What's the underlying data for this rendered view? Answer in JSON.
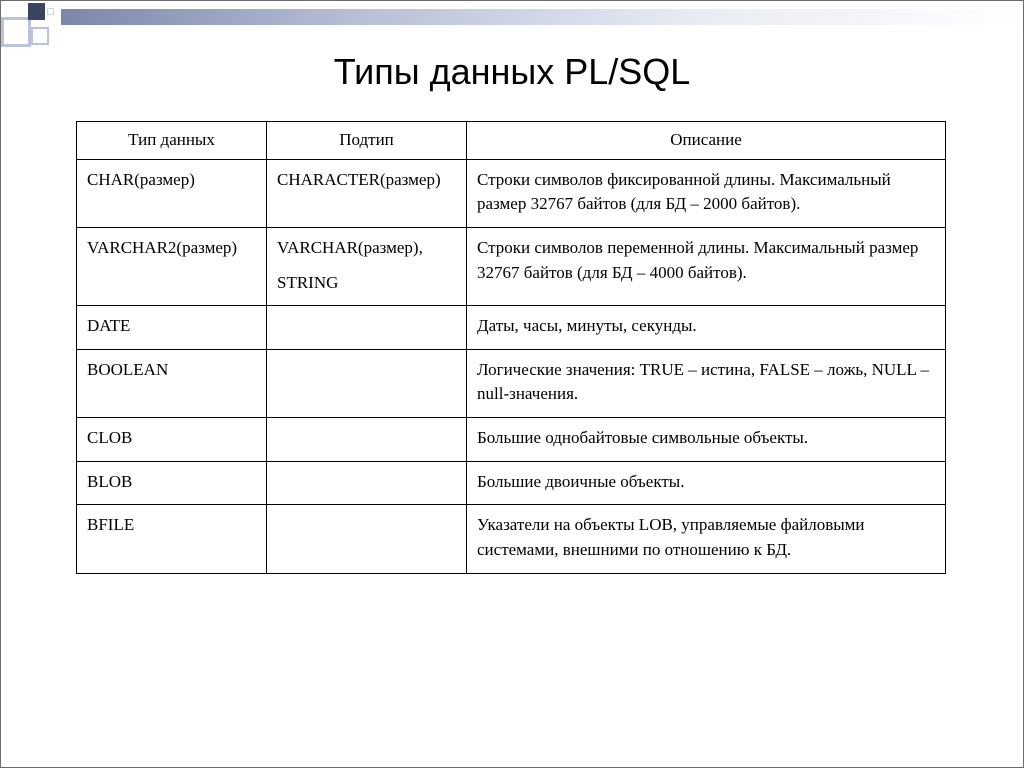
{
  "title": "Типы данных PL/SQL",
  "columns": {
    "c1": "Тип данных",
    "c2": "Подтип",
    "c3": "Описание"
  },
  "rows": [
    {
      "type": "CHAR(размер)",
      "sub1": "CHARACTER(размер)",
      "sub2": "",
      "desc": "Строки символов фиксированной длины. Максимальный размер 32767 байтов (для БД – 2000 байтов)."
    },
    {
      "type": "VARCHAR2(размер)",
      "sub1": "VARCHAR(размер),",
      "sub2": "STRING",
      "desc": "Строки символов переменной длины. Максимальный размер 32767 байтов (для БД – 4000 байтов)."
    },
    {
      "type": "DATE",
      "sub1": "",
      "sub2": "",
      "desc": "Даты, часы, минуты, секунды."
    },
    {
      "type": "BOOLEAN",
      "sub1": "",
      "sub2": "",
      "desc": "Логические значения: TRUE – истина, FALSE – ложь, NULL – null-значения."
    },
    {
      "type": "CLOB",
      "sub1": "",
      "sub2": "",
      "desc": "Большие однобайтовые символьные объекты."
    },
    {
      "type": "BLOB",
      "sub1": "",
      "sub2": "",
      "desc": "Большие двоичные объекты."
    },
    {
      "type": "BFILE",
      "sub1": "",
      "sub2": "",
      "desc": "Указатели на объекты LOB, управляемые файловыми системами, внешними по отношению к БД."
    }
  ]
}
